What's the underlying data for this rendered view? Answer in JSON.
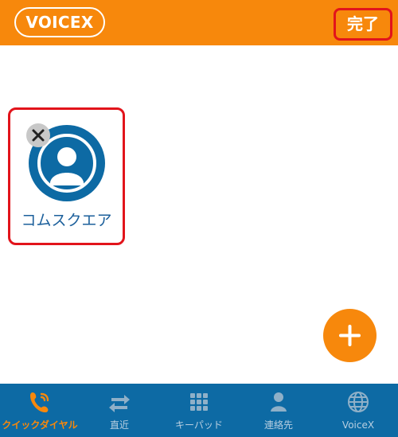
{
  "header": {
    "logo_text": "VOICEX",
    "done_label": "完了"
  },
  "favorites": {
    "items": [
      {
        "name": "コムスクエア",
        "icon": "person-avatar-icon"
      }
    ]
  },
  "fab": {
    "icon": "plus-icon"
  },
  "bottom_nav": {
    "items": [
      {
        "label": "クイックダイヤル",
        "icon": "phone-icon",
        "active": true
      },
      {
        "label": "直近",
        "icon": "recent-arrows-icon",
        "active": false
      },
      {
        "label": "キーパッド",
        "icon": "keypad-icon",
        "active": false
      },
      {
        "label": "連絡先",
        "icon": "contact-icon",
        "active": false
      },
      {
        "label": "VoiceX",
        "icon": "globe-icon",
        "active": false
      }
    ]
  },
  "colors": {
    "accent": "#f7880c",
    "highlight": "#e2141b",
    "nav_bg": "#0d6aa4",
    "contact_blue": "#1b5f9b"
  }
}
